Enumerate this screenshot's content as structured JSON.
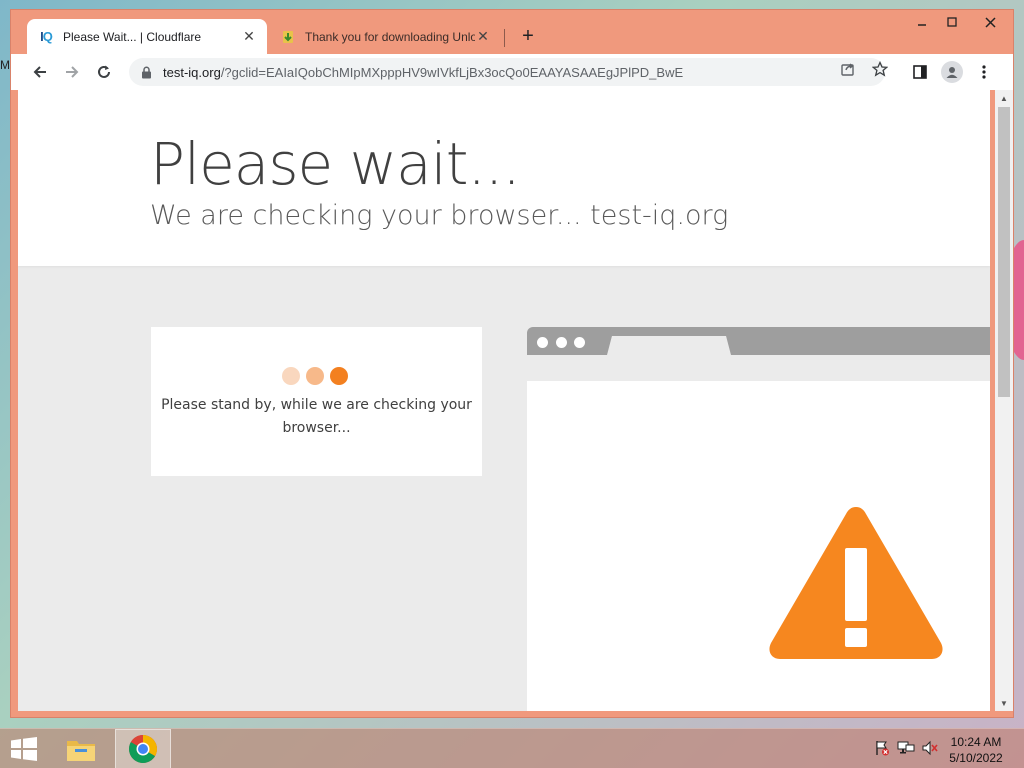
{
  "browser": {
    "tabs": [
      {
        "title": "Please Wait... | Cloudflare",
        "favicon": "IQ",
        "active": true
      },
      {
        "title": "Thank you for downloading Unlo",
        "active": false
      }
    ],
    "url": {
      "host": "test-iq.org",
      "path": "/?gclid=EAIaIQobChMIpMXpppHV9wIVkfLjBx3ocQo0EAAYASAAEgJPlPD_BwE"
    }
  },
  "page": {
    "heading": "Please wait...",
    "subheading": "We are checking your browser... test-iq.org",
    "standby_text": "Please stand by, while we are checking your browser...",
    "dot_colors": [
      "#f9d7be",
      "#f7b98a",
      "#f38020"
    ],
    "accent_color": "#f6871f"
  },
  "taskbar": {
    "time": "10:24 AM",
    "date": "5/10/2022"
  }
}
